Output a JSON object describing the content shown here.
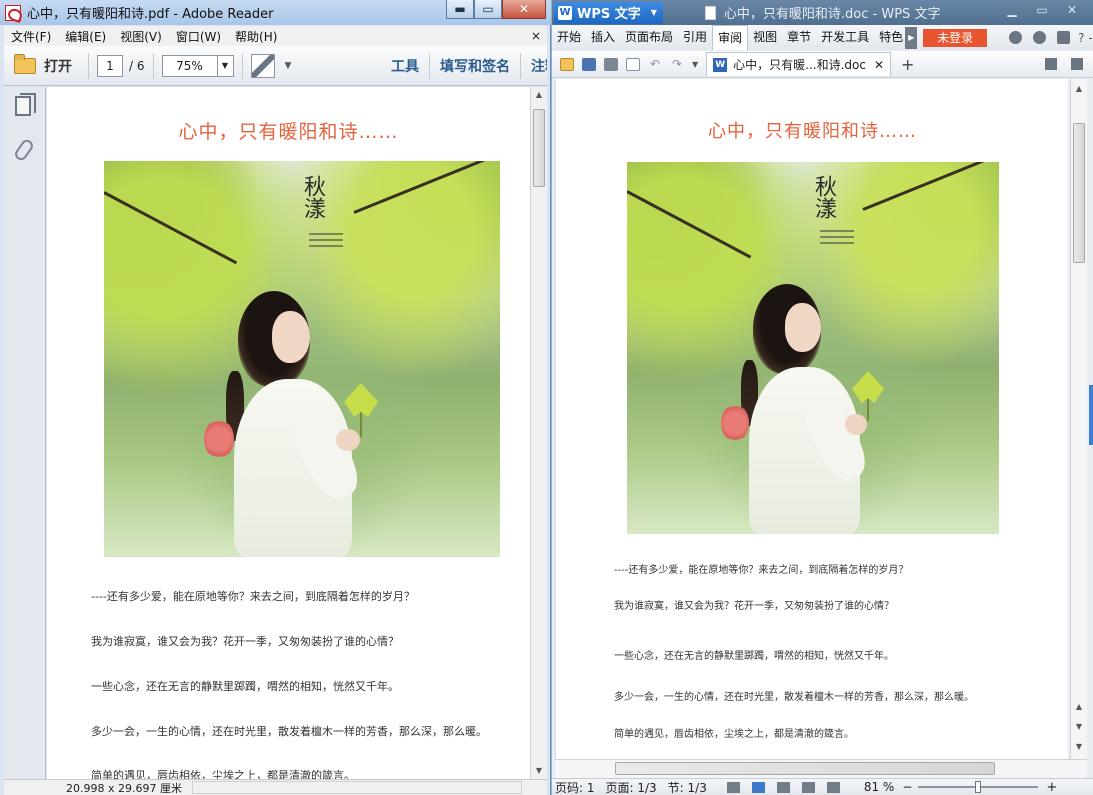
{
  "reader": {
    "title": "心中，只有暖阳和诗.pdf - Adobe Reader",
    "window_controls": {
      "minimize": "▬",
      "maximize": "▭",
      "close": "✕"
    },
    "menu": [
      "文件(F)",
      "编辑(E)",
      "视图(V)",
      "窗口(W)",
      "帮助(H)"
    ],
    "menu_close": "×",
    "toolbar": {
      "open_label": "打开",
      "page_current": "1",
      "page_total": "/ 6",
      "zoom": "75%",
      "tools_label": "工具",
      "fill_sign_label": "填写和签名",
      "comment_label": "注释"
    },
    "status": {
      "page_size": "20.998 x 29.697 厘米"
    },
    "document": {
      "title": "心中，只有暖阳和诗……",
      "photo_caption": "秋漾",
      "paragraphs": [
        "----还有多少爱，能在原地等你？来去之间，到底隔着怎样的岁月？",
        "我为谁寂寞，谁又会为我？花开一季，又匆匆装扮了谁的心情？",
        "一些心念，还在无言的静默里踯躅，喟然的相知，恍然又千年。",
        "多少一会，一生的心情，还在时光里，散发着檀木一样的芳香，那么深，那么暖。",
        "简单的遇见，唇齿相依，尘埃之上，都是清澈的箴言。"
      ]
    }
  },
  "wps": {
    "brand": "WPS 文字",
    "brand_logo": "W",
    "title": "心中，只有暖阳和诗.doc - WPS 文字",
    "ribbon_tabs": [
      "开始",
      "插入",
      "页面布局",
      "引用",
      "审阅",
      "视图",
      "章节",
      "开发工具",
      "特色"
    ],
    "active_tab": "审阅",
    "login_label": "未登录",
    "help_label": "? -",
    "doc_tab": {
      "icon_letter": "W",
      "label": "心中，只有暖...和诗.doc",
      "close": "✕"
    },
    "new_tab": "+",
    "status": {
      "page_number": "页码: 1",
      "pages": "页面: 1/3",
      "section": "节: 1/3",
      "zoom": "81 %",
      "zoom_minus": "−",
      "zoom_plus": "+",
      "zoom_level": 0.5
    },
    "document": {
      "title": "心中，只有暖阳和诗……",
      "photo_caption": "秋漾",
      "paragraphs": [
        "----还有多少爱，能在原地等你？来去之间，到底隔着怎样的岁月？",
        "我为谁寂寞，谁又会为我？花开一季，又匆匆装扮了谁的心情？",
        "一些心念，还在无言的静默里踯躅，喟然的相知，恍然又千年。",
        "多少一会，一生的心情，还在时光里，散发着檀木一样的芳香，那么深，那么暖。",
        "简单的遇见，唇齿相依，尘埃之上，都是清澈的箴言。"
      ]
    }
  }
}
